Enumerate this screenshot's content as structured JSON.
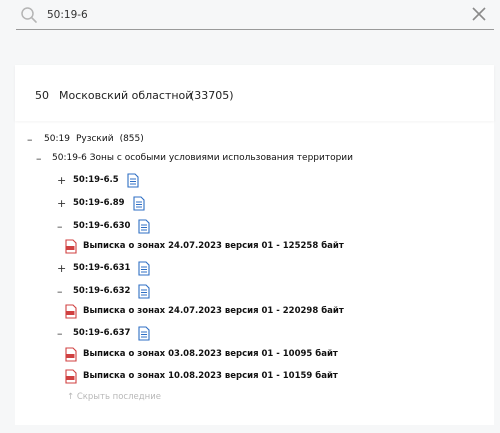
{
  "search": {
    "value": "50:19-6"
  },
  "region": {
    "code": "50",
    "name": "Московский областной",
    "count": "(33705)"
  },
  "tree": {
    "district": {
      "toggle": "–",
      "code": "50:19",
      "name": "Рузский",
      "count": "(855)"
    },
    "zone": {
      "toggle": "–",
      "label": "50:19-6 Зоны с особыми условиями использования территории"
    },
    "items": [
      {
        "toggle": "+",
        "code": "50:19-6.5"
      },
      {
        "toggle": "+",
        "code": "50:19-6.89"
      },
      {
        "toggle": "–",
        "code": "50:19-6.630"
      },
      {
        "doc": "Выписка о зонах 24.07.2023 версия 01 - 125258 байт"
      },
      {
        "toggle": "+",
        "code": "50:19-6.631"
      },
      {
        "toggle": "–",
        "code": "50:19-6.632"
      },
      {
        "doc": "Выписка о зонах 24.07.2023 версия 01 - 220298 байт"
      },
      {
        "toggle": "–",
        "code": "50:19-6.637"
      },
      {
        "doc": "Выписка о зонах 03.08.2023 версия 01 - 10095 байт"
      },
      {
        "doc": "Выписка о зонах 10.08.2023 версия 01 - 10159 байт"
      }
    ],
    "hide_label": "↑  Скрыть последние"
  },
  "colors": {
    "doc_icon": "#2f6fc4",
    "pdf_icon": "#d04040",
    "muted": "#b8b8b8"
  },
  "icons": {
    "search": "search-icon",
    "close": "close-icon",
    "folder_doc": "document-icon",
    "pdf": "pdf-file-icon"
  }
}
